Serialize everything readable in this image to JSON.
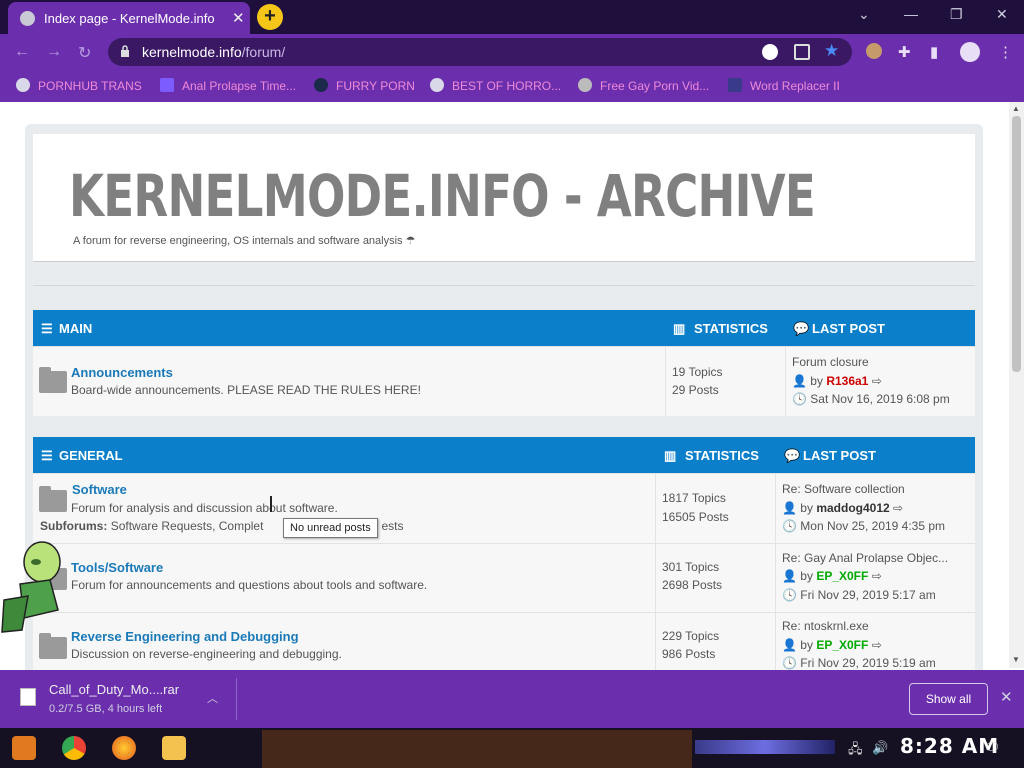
{
  "browser": {
    "tab_title": "Index page - KernelMode.info",
    "tab_close": "✕",
    "new_tab": "+",
    "url_host": "kernelmode.info",
    "url_path": "/forum/",
    "bookmarks": [
      {
        "label": "PORNHUB TRANS"
      },
      {
        "label": "Anal Prolapse Time..."
      },
      {
        "label": "FURRY PORN"
      },
      {
        "label": "BEST OF HORRO..."
      },
      {
        "label": "Free Gay Porn Vid..."
      },
      {
        "label": "Word Replacer II"
      }
    ]
  },
  "site": {
    "name": "KERNELMODE.INFO - ARCHIVE",
    "description": "A forum for reverse engineering, OS internals and software analysis ☂"
  },
  "sections": [
    {
      "title": "MAIN",
      "stats_header": "STATISTICS",
      "last_header": "LAST POST",
      "forums": [
        {
          "name": "Announcements",
          "desc": "Board-wide announcements. PLEASE READ THE RULES HERE!",
          "topics": "19 Topics",
          "posts": "29 Posts",
          "last_title": "Forum closure",
          "last_by": "by",
          "last_user": "R136a1",
          "last_date": "Sat Nov 16, 2019 6:08 pm"
        }
      ]
    },
    {
      "title": "GENERAL",
      "stats_header": "STATISTICS",
      "last_header": "LAST POST",
      "forums": [
        {
          "name": "Software",
          "desc": "Forum for analysis and discussion about software.",
          "subforums_label": "Subforums:",
          "subforums": "Software Requests, Complet",
          "subforums_tail": "ests",
          "topics": "1817 Topics",
          "posts": "16505 Posts",
          "last_title": "Re: Software collection",
          "last_by": "by",
          "last_user": "maddog4012",
          "last_date": "Mon Nov 25, 2019 4:35 pm"
        },
        {
          "name": "Tools/Software",
          "desc": "Forum for announcements and questions about tools and software.",
          "topics": "301 Topics",
          "posts": "2698 Posts",
          "last_title": "Re: Gay Anal Prolapse Objec...",
          "last_by": "by",
          "last_user": "EP_X0FF",
          "last_date": "Fri Nov 29, 2019 5:17 am"
        },
        {
          "name": "Reverse Engineering and Debugging",
          "desc": "Discussion on reverse-engineering and debugging.",
          "topics": "229 Topics",
          "posts": "986 Posts",
          "last_title": "Re: ntoskrnl.exe",
          "last_by": "by",
          "last_user": "EP_X0FF",
          "last_date": "Fri Nov 29, 2019 5:19 am"
        }
      ]
    }
  ],
  "tooltip": "No unread posts",
  "download": {
    "file": "Call_of_Duty_Mo....rar",
    "meta": "0.2/7.5 GB, 4 hours left",
    "show_all": "Show all"
  },
  "taskbar": {
    "clock": "8:28 AM"
  },
  "colors": {
    "accent": "#6b2fae",
    "forum_header": "#0b7fc9",
    "link": "#1a7ab8"
  }
}
